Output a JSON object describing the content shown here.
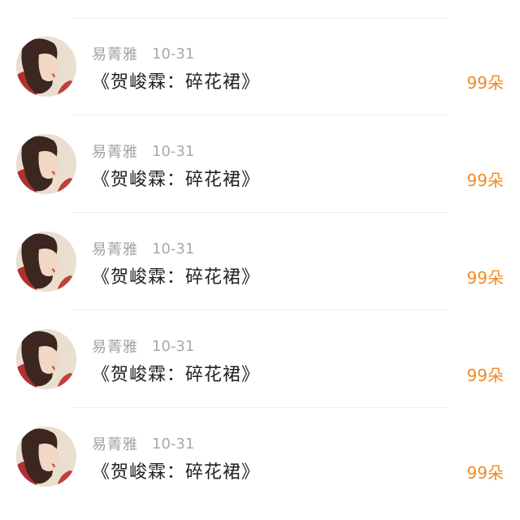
{
  "items": [
    {
      "name": "易菁雅",
      "date": "10-31",
      "title": "《贺峻霖：碎花裙》",
      "count": "99朵"
    },
    {
      "name": "易菁雅",
      "date": "10-31",
      "title": "《贺峻霖：碎花裙》",
      "count": "99朵"
    },
    {
      "name": "易菁雅",
      "date": "10-31",
      "title": "《贺峻霖：碎花裙》",
      "count": "99朵"
    },
    {
      "name": "易菁雅",
      "date": "10-31",
      "title": "《贺峻霖：碎花裙》",
      "count": "99朵"
    },
    {
      "name": "易菁雅",
      "date": "10-31",
      "title": "《贺峻霖：碎花裙》",
      "count": "99朵"
    }
  ],
  "colors": {
    "name": "#a2a2a2",
    "date": "#a9a9a9",
    "title": "#222222",
    "count": "#f08a24",
    "divider": "#f0f0f0"
  },
  "icons": {
    "avatar": "user-avatar-photo"
  }
}
